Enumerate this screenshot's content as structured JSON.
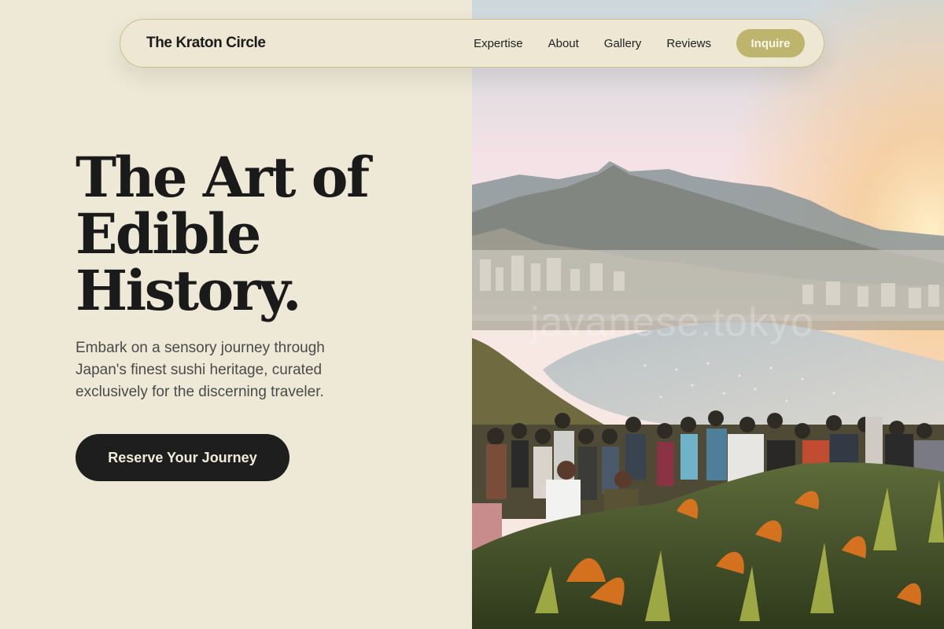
{
  "header": {
    "brand": "The Kraton Circle",
    "nav": [
      {
        "label": "Expertise"
      },
      {
        "label": "About"
      },
      {
        "label": "Gallery"
      },
      {
        "label": "Reviews"
      }
    ],
    "cta_label": "Inquire"
  },
  "hero": {
    "title_lines": [
      "The Art of",
      "Edible",
      "History."
    ],
    "subtitle_lines": [
      "Embark on a sensory journey through",
      "Japan's finest sushi heritage, curated",
      "exclusively for the discerning traveler."
    ],
    "cta_label": "Reserve Your Journey"
  },
  "image": {
    "watermark": "javanese.tokyo"
  },
  "colors": {
    "background": "#eee8d6",
    "accent": "#bdb46e",
    "dark": "#1e1e1e"
  }
}
